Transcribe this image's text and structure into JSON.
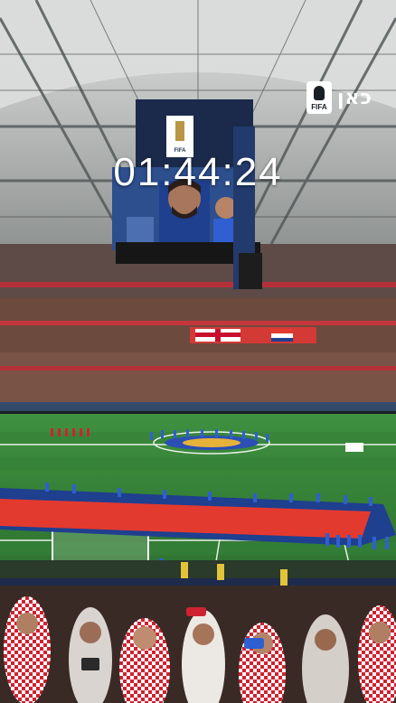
{
  "overlay": {
    "timer": "01:44:24",
    "logo_badge_text": "FIFA",
    "logo_text": "כאן"
  },
  "screen": {
    "badge_text": "FIFA"
  },
  "colors": {
    "pitch": "#3c8a3a",
    "pitch_dark": "#2f7330",
    "flag_red": "#e33a2f",
    "flag_blue": "#1f3f8f",
    "stand": "#6d4a3e",
    "roof": "#c9ccca",
    "fan_checker_red": "#cf2231",
    "player_blue": "#2f5fd1"
  }
}
